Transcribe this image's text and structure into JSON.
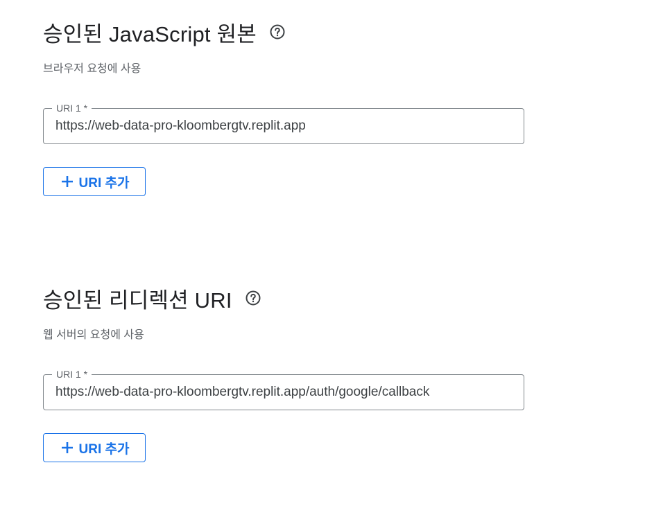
{
  "javascript_origins": {
    "title": "승인된 JavaScript 원본",
    "help_icon": "help-circle-icon",
    "subtitle": "브라우저 요청에 사용",
    "uri_field": {
      "label": "URI 1 *",
      "value": "https://web-data-pro-kloombergtv.replit.app"
    },
    "add_button": {
      "icon": "plus-icon",
      "label": "URI 추가"
    }
  },
  "redirect_uris": {
    "title": "승인된 리디렉션 URI",
    "help_icon": "help-circle-icon",
    "subtitle": "웹 서버의 요청에 사용",
    "uri_field": {
      "label": "URI 1 *",
      "value": "https://web-data-pro-kloombergtv.replit.app/auth/google/callback"
    },
    "add_button": {
      "icon": "plus-icon",
      "label": "URI 추가"
    }
  },
  "colors": {
    "accent": "#1a73e8",
    "text_primary": "#202124",
    "text_secondary": "#5f6368",
    "field_border": "#80868b"
  }
}
